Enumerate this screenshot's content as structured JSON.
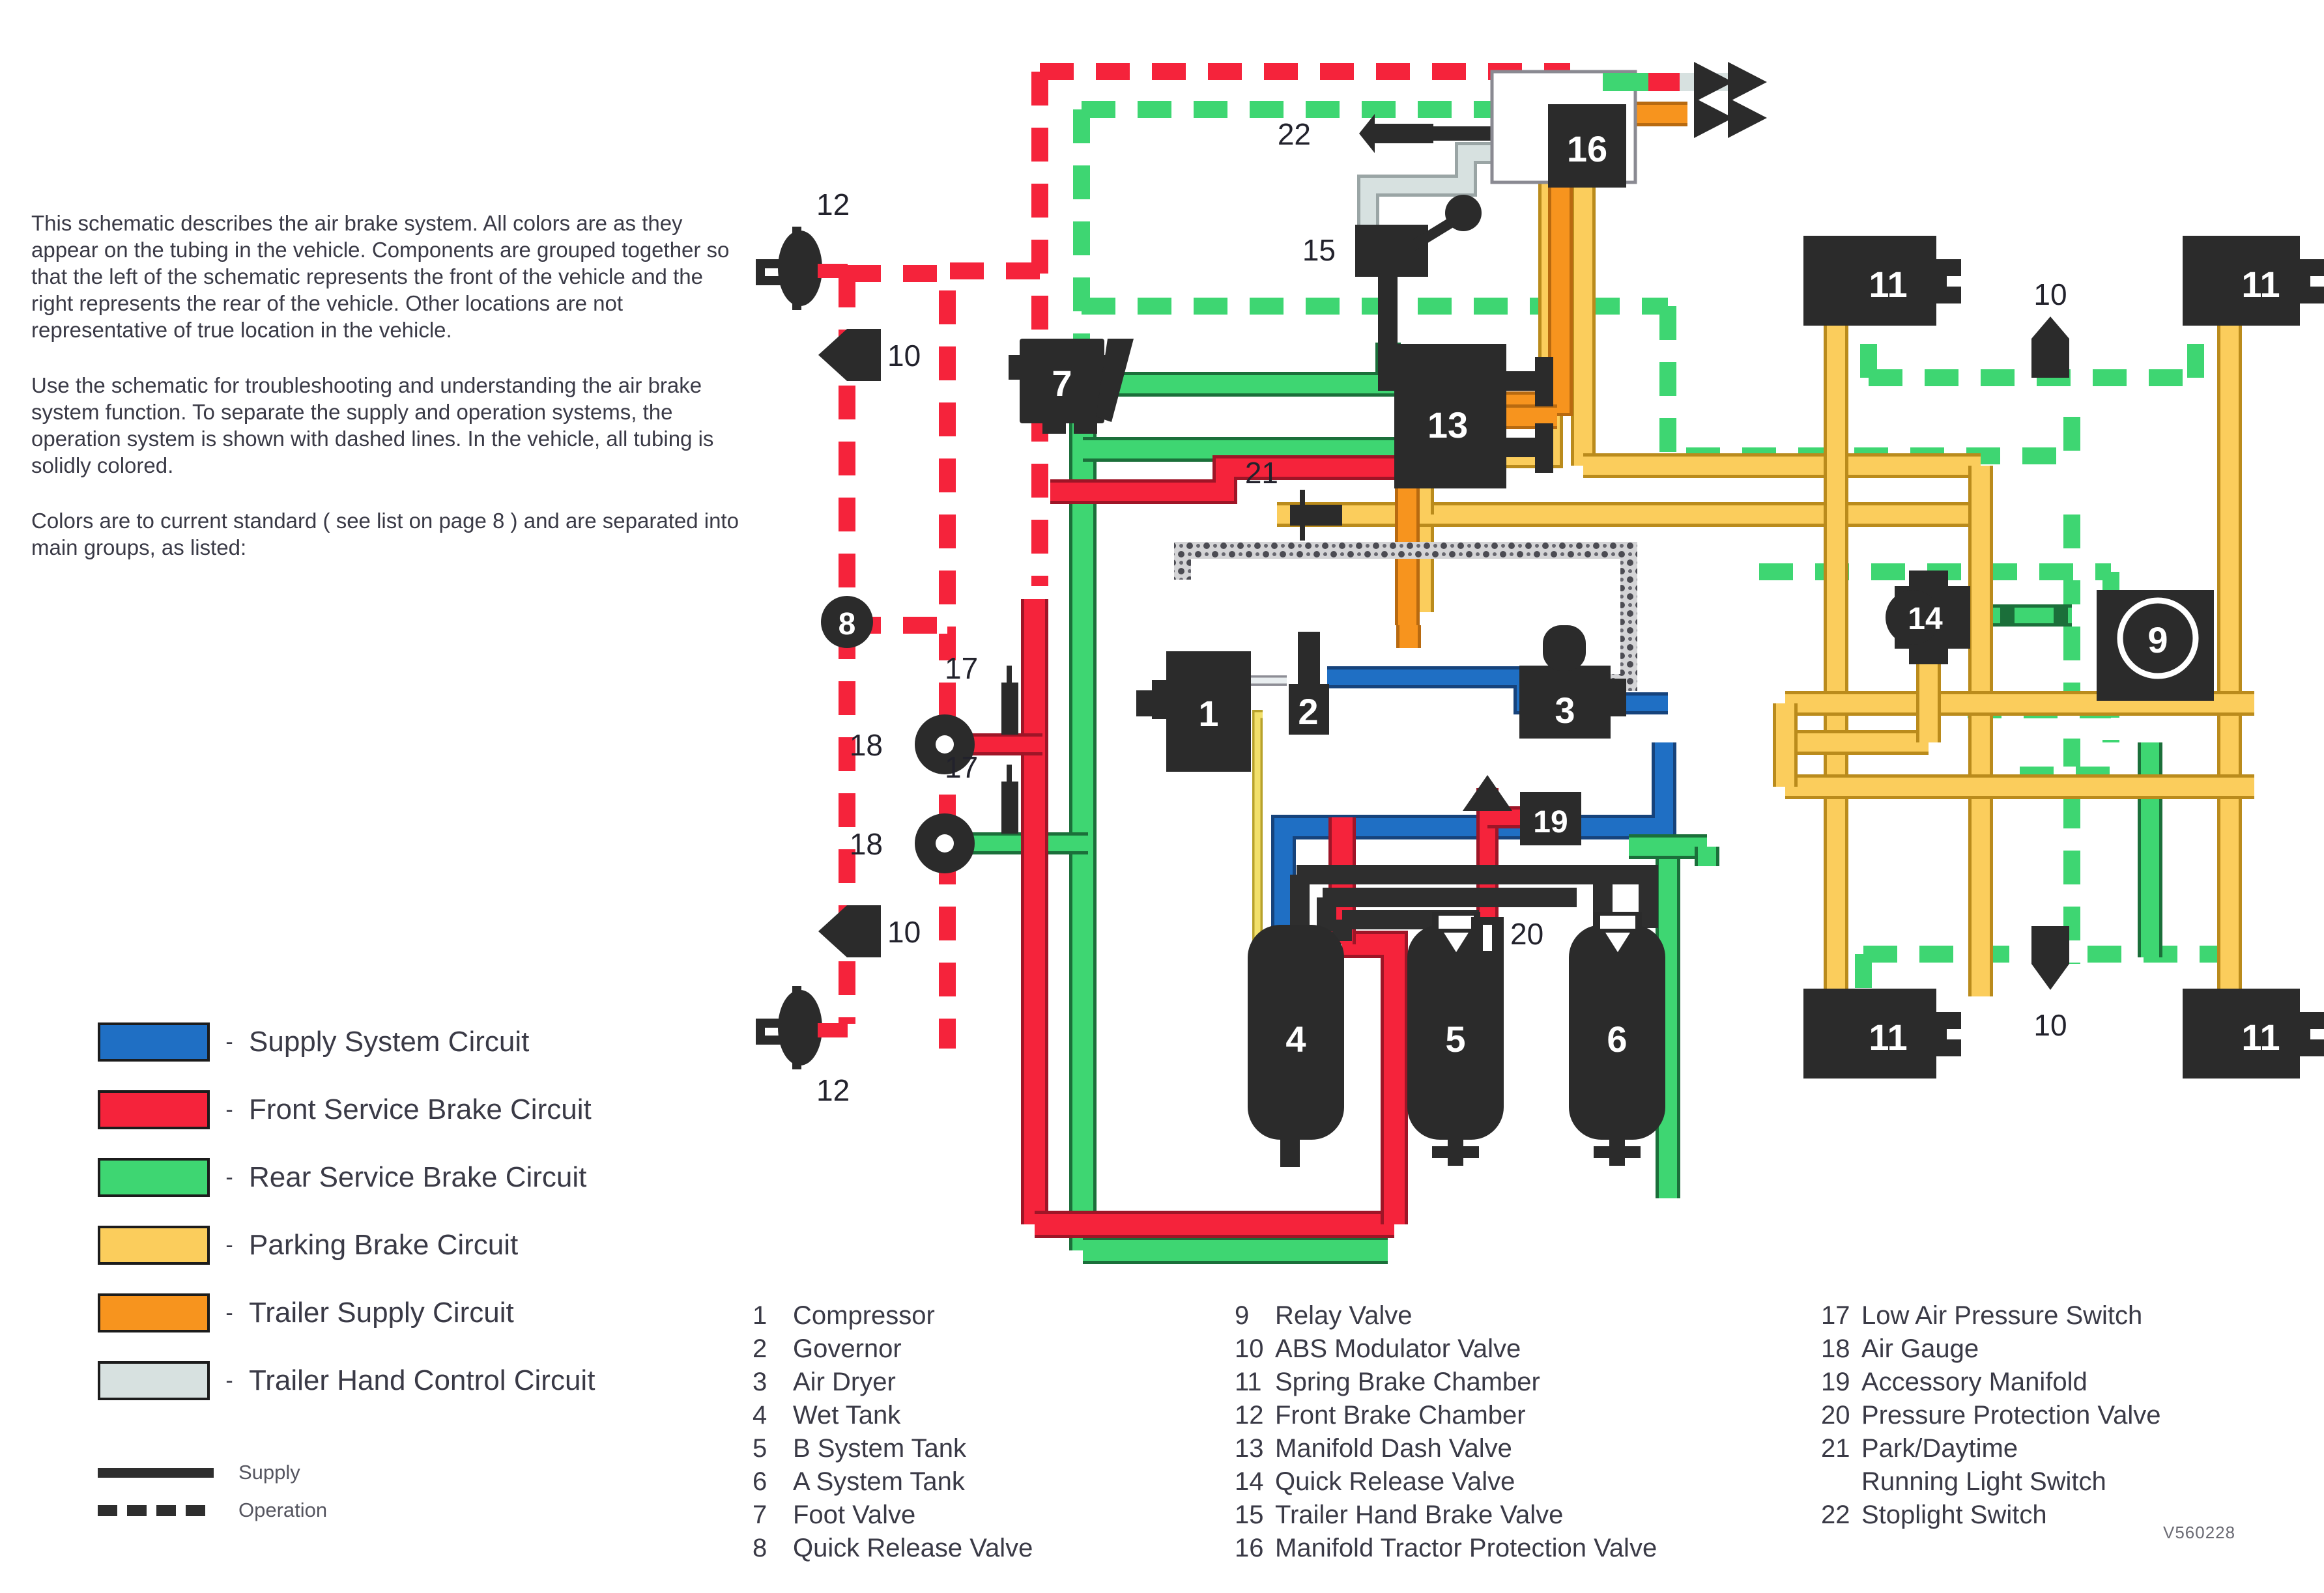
{
  "intro": {
    "paragraphs": [
      "This schematic describes the air brake system. All colors are as they appear on the tubing in the vehicle. Components are grouped together so that the left of the schematic represents the front of the vehicle and the right represents the rear of the vehicle. Other locations are not representative of true location in the vehicle.",
      "Use the schematic for troubleshooting and understanding the air brake system function. To separate the supply and operation systems, the operation system is shown with dashed lines. In the vehicle, all tubing is solidly colored.",
      "Colors are to current standard ( see list on page 8 ) and are separated into main groups, as listed:"
    ]
  },
  "legend": {
    "dash": "-",
    "entries": [
      {
        "label": "Supply System Circuit",
        "color": "#1f6fc4"
      },
      {
        "label": "Front Service Brake Circuit",
        "color": "#f5233b"
      },
      {
        "label": "Rear Service Brake Circuit",
        "color": "#3ed672"
      },
      {
        "label": "Parking Brake Circuit",
        "color": "#fbcd5c"
      },
      {
        "label": "Trailer Supply Circuit",
        "color": "#f7941e"
      },
      {
        "label": "Trailer Hand Control Circuit",
        "color": "#d7e1e0"
      }
    ],
    "line_styles": [
      {
        "label": "Supply",
        "style": "solid"
      },
      {
        "label": "Operation",
        "style": "dashed"
      }
    ]
  },
  "component_key": {
    "column_1": [
      {
        "num": "1",
        "name": "Compressor"
      },
      {
        "num": "2",
        "name": "Governor"
      },
      {
        "num": "3",
        "name": "Air Dryer"
      },
      {
        "num": "4",
        "name": "Wet Tank"
      },
      {
        "num": "5",
        "name": "B System Tank"
      },
      {
        "num": "6",
        "name": "A System Tank"
      },
      {
        "num": "7",
        "name": "Foot Valve"
      },
      {
        "num": "8",
        "name": "Quick Release Valve"
      }
    ],
    "column_2": [
      {
        "num": "9",
        "name": "Relay Valve"
      },
      {
        "num": "10",
        "name": "ABS Modulator Valve"
      },
      {
        "num": "11",
        "name": "Spring Brake Chamber"
      },
      {
        "num": "12",
        "name": "Front Brake Chamber"
      },
      {
        "num": "13",
        "name": "Manifold Dash Valve"
      },
      {
        "num": "14",
        "name": "Quick Release Valve"
      },
      {
        "num": "15",
        "name": "Trailer Hand Brake Valve"
      },
      {
        "num": "16",
        "name": "Manifold Tractor Protection Valve"
      }
    ],
    "column_3": [
      {
        "num": "17",
        "name": "Low Air Pressure Switch"
      },
      {
        "num": "18",
        "name": "Air Gauge"
      },
      {
        "num": "19",
        "name": "Accessory Manifold"
      },
      {
        "num": "20",
        "name": "Pressure Protection Valve"
      },
      {
        "num": "21",
        "name": "Park/Daytime"
      },
      {
        "num": "",
        "name": "Running Light Switch",
        "continuation": true
      },
      {
        "num": "22",
        "name": "Stoplight Switch"
      }
    ]
  },
  "drawing_code": "V560228",
  "diagram": {
    "callouts": {
      "c1": "1",
      "c2": "2",
      "c3": "3",
      "c4": "4",
      "c5": "5",
      "c6": "6",
      "c7": "7",
      "c8": "8",
      "c9": "9",
      "c10_front_upper": "10",
      "c10_front_lower": "10",
      "c10_rear_upper": "10",
      "c10_rear_lower": "10",
      "c11_tl": "11",
      "c11_tr": "11",
      "c11_bl": "11",
      "c11_br": "11",
      "c12_top": "12",
      "c12_bottom": "12",
      "c13": "13",
      "c14": "14",
      "c15": "15",
      "c16": "16",
      "c17_upper": "17",
      "c17_lower": "17",
      "c18_upper": "18",
      "c18_lower": "18",
      "c19": "19",
      "c20": "20",
      "c21": "21",
      "c22": "22"
    },
    "colors": {
      "supply_blue": "#1f6fc4",
      "front_service_red": "#f5233b",
      "rear_service_green": "#3ed672",
      "parking_yellow": "#fbcd5c",
      "trailer_supply_orange": "#f7941e",
      "trailer_hand_gray": "#d7e1e0",
      "component_black": "#2b2b2b",
      "outline": "#33333a"
    }
  }
}
